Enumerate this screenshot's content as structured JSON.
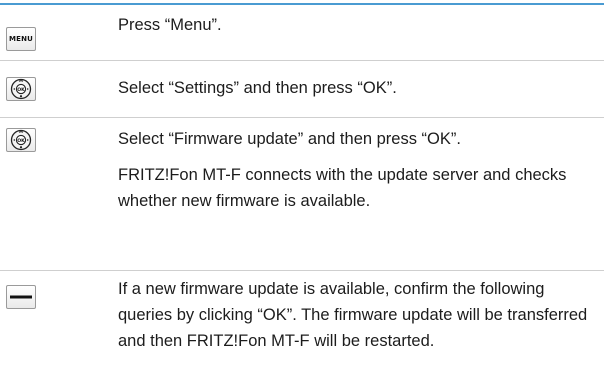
{
  "steps": [
    {
      "icon": "menu-key-icon",
      "icon_label": "MENU",
      "texts": [
        "Press “Menu”."
      ]
    },
    {
      "icon": "navigation-ok-key-icon",
      "texts": [
        "Select “Settings” and then press “OK”."
      ]
    },
    {
      "icon": "navigation-ok-key-icon",
      "texts": [
        "Select “Firmware update” and then press “OK”.",
        "FRITZ!Fon MT-F connects with the update server and checks whether new firmware is available."
      ]
    },
    {
      "icon": "softkey-dash-icon",
      "texts": [
        "If a new firmware update is available, confirm the following queries by clicking “OK”. The firmware update will be transferred and then FRITZ!Fon MT-F will be restarted."
      ]
    }
  ],
  "colors": {
    "accent_rule": "#4a9bd2",
    "separator": "#cfcfcf",
    "text": "#1c1c1c"
  }
}
